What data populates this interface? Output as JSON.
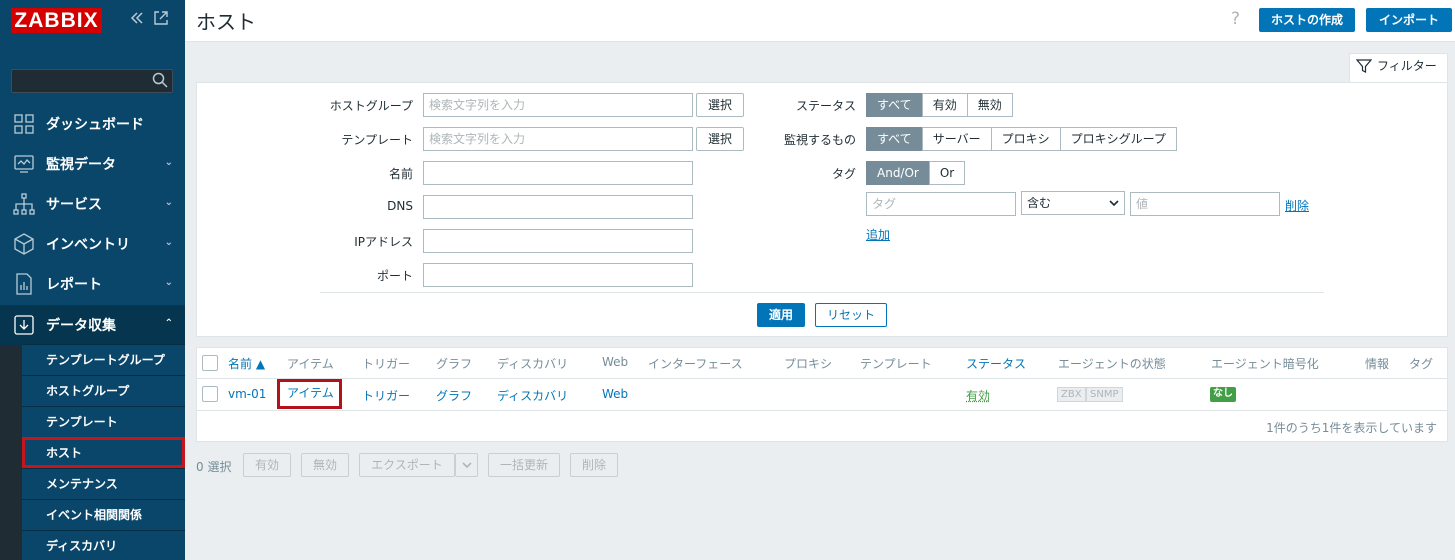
{
  "brand": {
    "logo": "ZABBIX",
    "logo_color": "#d40000"
  },
  "sidebar": {
    "collapse_icon": "double-chevron-left-icon",
    "popout_icon": "popout-icon",
    "search": {
      "placeholder": "",
      "icon": "search-icon"
    },
    "items": [
      {
        "label": "ダッシュボード",
        "icon": "dashboard-icon"
      },
      {
        "label": "監視データ",
        "icon": "monitoring-icon"
      },
      {
        "label": "サービス",
        "icon": "services-icon"
      },
      {
        "label": "インベントリ",
        "icon": "inventory-icon"
      },
      {
        "label": "レポート",
        "icon": "reports-icon"
      },
      {
        "label": "データ収集",
        "icon": "data-collection-icon"
      }
    ],
    "submenu": [
      "テンプレートグループ",
      "ホストグループ",
      "テンプレート",
      "ホスト",
      "メンテナンス",
      "イベント相関関係",
      "ディスカバリ"
    ]
  },
  "header": {
    "title": "ホスト",
    "help": "?",
    "create_host": "ホストの作成",
    "import": "インポート"
  },
  "filter": {
    "tab_label": "フィルター",
    "hostgroup_label": "ホストグループ",
    "hostgroup_placeholder": "検索文字列を入力",
    "template_label": "テンプレート",
    "template_placeholder": "検索文字列を入力",
    "select": "選択",
    "name_label": "名前",
    "dns_label": "DNS",
    "ip_label": "IPアドレス",
    "port_label": "ポート",
    "status_label": "ステータス",
    "status_options": [
      "すべて",
      "有効",
      "無効"
    ],
    "monitored_label": "監視するもの",
    "monitored_options": [
      "すべて",
      "サーバー",
      "プロキシ",
      "プロキシグループ"
    ],
    "tag_label": "タグ",
    "tag_options": [
      "And/Or",
      "Or"
    ],
    "tag_placeholder": "タグ",
    "tag_operator": "含む",
    "value_placeholder": "値",
    "remove": "削除",
    "add": "追加",
    "apply": "適用",
    "reset": "リセット"
  },
  "table": {
    "headers": [
      "名前 ▲",
      "アイテム",
      "トリガー",
      "グラフ",
      "ディスカバリ",
      "Web",
      "インターフェース",
      "プロキシ",
      "テンプレート",
      "ステータス",
      "エージェントの状態",
      "エージェント暗号化",
      "情報",
      "タグ"
    ],
    "row": {
      "name": "vm-01",
      "items": "アイテム",
      "triggers": "トリガー",
      "graphs": "グラフ",
      "discovery": "ディスカバリ",
      "web": "Web",
      "status": "有効",
      "zbx": "ZBX",
      "snmp": "SNMP",
      "encryption": "なし"
    },
    "footer": "1件のうち1件を表示しています"
  },
  "bulk": {
    "selected": "0 選択",
    "enable": "有効",
    "disable": "無効",
    "export": "エクスポート",
    "mass_update": "一括更新",
    "delete": "削除"
  },
  "colors": {
    "accent": "#0275b8",
    "highlight": "#c4161c",
    "status_ok": "#429e47"
  }
}
